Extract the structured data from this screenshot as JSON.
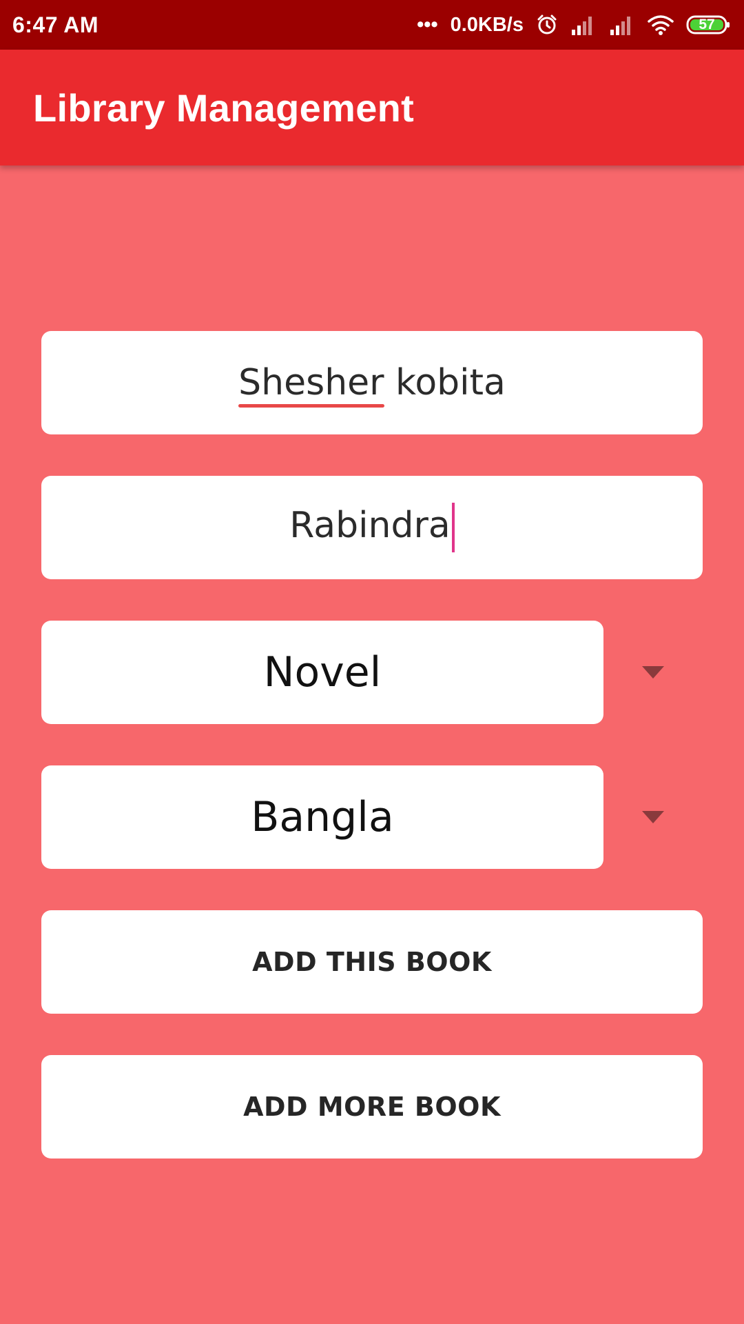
{
  "status_bar": {
    "time": "6:47 AM",
    "dots": "•••",
    "network_speed": "0.0KB/s",
    "battery_level": "57",
    "icons": [
      "alarm-icon",
      "signal-icon",
      "signal-icon",
      "wifi-icon",
      "battery-icon"
    ]
  },
  "app_bar": {
    "title": "Library Management"
  },
  "form": {
    "book_name": {
      "value_part1": "Shesher",
      "value_part2": " kobita"
    },
    "author": {
      "value": "Rabindra"
    },
    "category": {
      "selected": "Novel"
    },
    "language": {
      "selected": "Bangla"
    },
    "add_this_book_label": "ADD THIS BOOK",
    "add_more_book_label": "ADD MORE BOOK"
  },
  "colors": {
    "status_bar": "#9b0000",
    "app_bar": "#ea2a2e",
    "background": "#f7676b",
    "cursor": "#e0358a",
    "spellcheck_underline": "#e84848"
  }
}
